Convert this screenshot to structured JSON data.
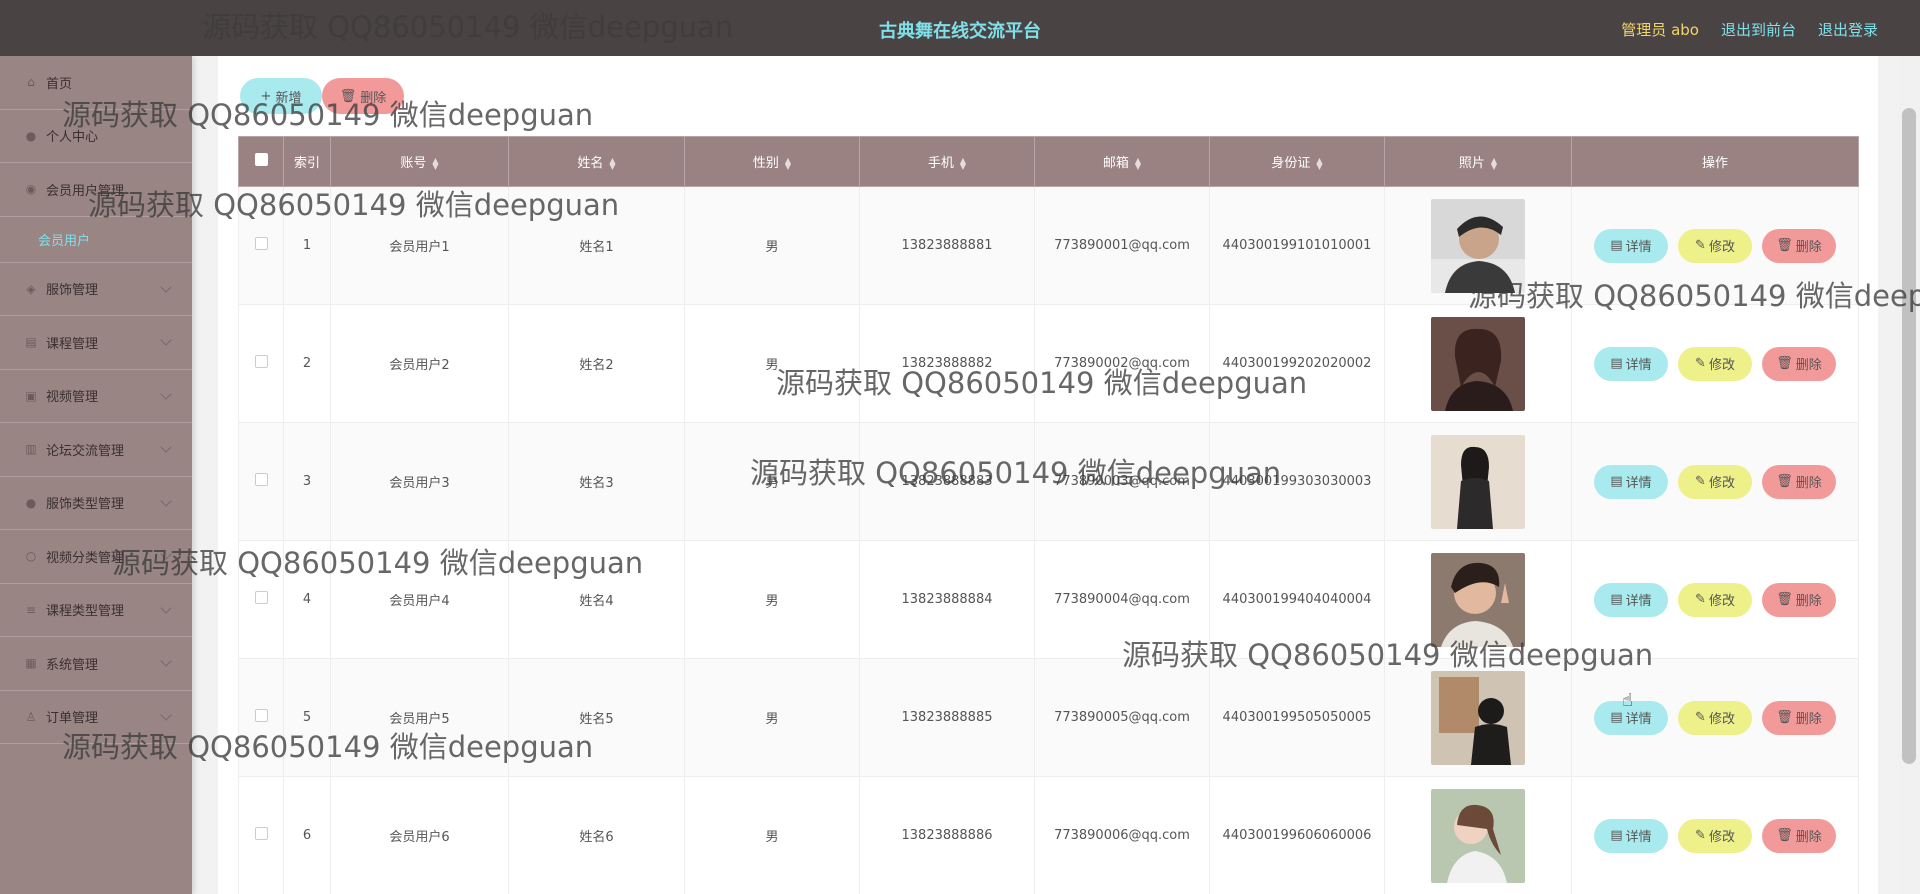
{
  "header": {
    "title": "古典舞在线交流平台",
    "user": "管理员 abo",
    "to_front": "退出到前台",
    "logout": "退出登录"
  },
  "sidebar": {
    "items": [
      {
        "label": "首页",
        "icon": "home-icon"
      },
      {
        "label": "个人中心",
        "icon": "user-icon"
      },
      {
        "label": "会员用户管理",
        "icon": "users-icon"
      },
      {
        "label": "服饰管理",
        "icon": "shirt-icon"
      },
      {
        "label": "课程管理",
        "icon": "book-icon"
      },
      {
        "label": "视频管理",
        "icon": "video-icon"
      },
      {
        "label": "论坛交流管理",
        "icon": "chat-icon"
      },
      {
        "label": "服饰类型管理",
        "icon": "tag-icon"
      },
      {
        "label": "视频分类管理",
        "icon": "folder-icon"
      },
      {
        "label": "课程类型管理",
        "icon": "list-icon"
      },
      {
        "label": "系统管理",
        "icon": "grid-icon"
      },
      {
        "label": "订单管理",
        "icon": "order-icon"
      }
    ],
    "submenu_active": "会员用户"
  },
  "toolbar": {
    "add_label": "新增",
    "delete_label": "删除"
  },
  "table": {
    "columns": [
      "索引",
      "账号",
      "姓名",
      "性别",
      "手机",
      "邮箱",
      "身份证",
      "照片",
      "操作"
    ],
    "rows": [
      {
        "index": "1",
        "account": "会员用户1",
        "name": "姓名1",
        "gender": "男",
        "phone": "13823888881",
        "email": "773890001@qq.com",
        "idcard": "440300199101010001"
      },
      {
        "index": "2",
        "account": "会员用户2",
        "name": "姓名2",
        "gender": "男",
        "phone": "13823888882",
        "email": "773890002@qq.com",
        "idcard": "440300199202020002"
      },
      {
        "index": "3",
        "account": "会员用户3",
        "name": "姓名3",
        "gender": "男",
        "phone": "13823888883",
        "email": "773890003@qq.com",
        "idcard": "440300199303030003"
      },
      {
        "index": "4",
        "account": "会员用户4",
        "name": "姓名4",
        "gender": "男",
        "phone": "13823888884",
        "email": "773890004@qq.com",
        "idcard": "440300199404040004"
      },
      {
        "index": "5",
        "account": "会员用户5",
        "name": "姓名5",
        "gender": "男",
        "phone": "13823888885",
        "email": "773890005@qq.com",
        "idcard": "440300199505050005"
      },
      {
        "index": "6",
        "account": "会员用户6",
        "name": "姓名6",
        "gender": "男",
        "phone": "13823888886",
        "email": "773890006@qq.com",
        "idcard": "440300199606060006"
      }
    ],
    "actions": {
      "detail": "详情",
      "edit": "修改",
      "delete": "删除"
    }
  },
  "watermark": "源码获取 QQ86050149 微信deepguan",
  "colors": {
    "topbar": "#4a4343",
    "sidebar": "#9a8585",
    "table_header": "#9a8282",
    "accent_cyan": "#7fe0ea",
    "btn_detail": "#a9eaee",
    "btn_edit": "#eef08a",
    "btn_delete": "#f29a9a"
  }
}
